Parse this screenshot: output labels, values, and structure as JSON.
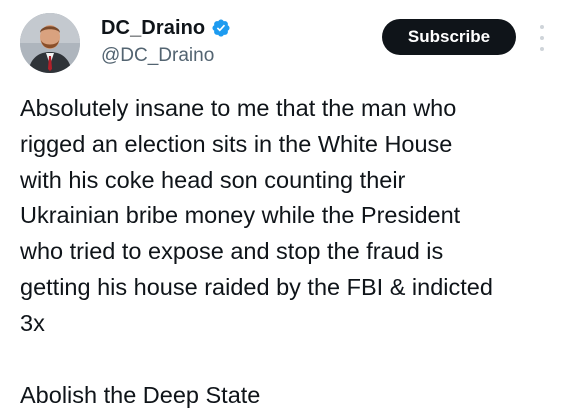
{
  "author": {
    "display_name": "DC_Draino",
    "handle": "@DC_Draino",
    "verified": true,
    "avatar_icon": "profile-photo"
  },
  "actions": {
    "subscribe_label": "Subscribe",
    "more_icon": "more-vertical-icon"
  },
  "post": {
    "lines": [
      "Absolutely insane to me that the man who",
      "rigged an election sits in the White House",
      "with his coke head son counting their",
      "Ukrainian bribe money while the President",
      "who tried to expose and stop the fraud is",
      "getting his house raided by the FBI & indicted",
      "3x"
    ],
    "closing": "Abolish the Deep State"
  },
  "colors": {
    "text": "#0f1419",
    "secondary": "#536471",
    "button_bg": "#0f1419",
    "verified_blue": "#1d9bf0"
  }
}
